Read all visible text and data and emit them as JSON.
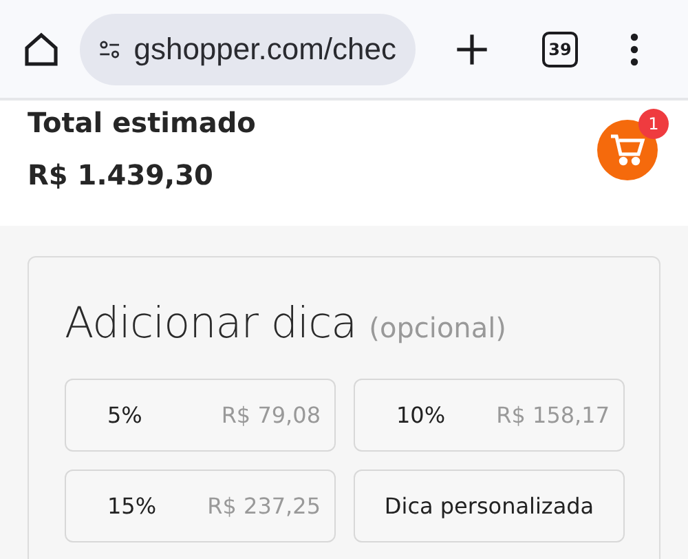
{
  "browser": {
    "url": "gshopper.com/chec",
    "tab_count": "39"
  },
  "summary": {
    "label": "Total estimado",
    "total": "R$ 1.439,30"
  },
  "cart": {
    "badge": "1"
  },
  "tip": {
    "title": "Adicionar dica",
    "subtitle": "(opcional)",
    "options": [
      {
        "kind": "percent",
        "label": "5%",
        "amount": "R$ 79,08"
      },
      {
        "kind": "percent",
        "label": "10%",
        "amount": "R$ 158,17"
      },
      {
        "kind": "percent",
        "label": "15%",
        "amount": "R$ 237,25"
      },
      {
        "kind": "custom",
        "label": "Dica personalizada"
      }
    ]
  }
}
